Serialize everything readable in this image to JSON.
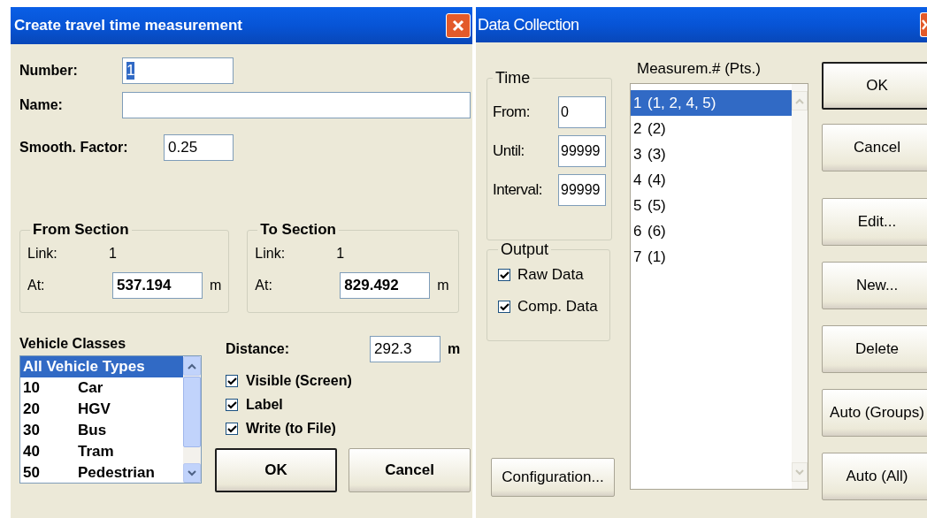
{
  "travel_time_dialog": {
    "title": "Create travel time measurement",
    "number": {
      "label": "Number:",
      "value": "1",
      "value_selected": true
    },
    "name": {
      "label": "Name:"
    },
    "smooth_factor": {
      "label": "Smooth. Factor:",
      "value": "0.25"
    },
    "sections": [
      {
        "title": "From Section",
        "link_label": "Link:",
        "link_value": "1",
        "at_label": "At:",
        "at_value": "537.194",
        "unit": "m"
      },
      {
        "title": "To Section",
        "link_label": "Link:",
        "link_value": "1",
        "at_label": "At:",
        "at_value": "829.492",
        "unit": "m"
      }
    ],
    "vehicle_classes": {
      "label": "Vehicle Classes",
      "items": [
        {
          "code": "All Vehicle Types",
          "selected": true
        },
        {
          "code": "10",
          "name": "Car",
          "selected": false
        },
        {
          "code": "20",
          "name": "HGV",
          "selected": false
        },
        {
          "code": "30",
          "name": "Bus",
          "selected": false
        },
        {
          "code": "40",
          "name": "Tram",
          "selected": false
        },
        {
          "code": "50",
          "name": "Pedestrian",
          "selected": false
        }
      ]
    },
    "distance": {
      "label": "Distance:",
      "value": "292.3",
      "unit": "m"
    },
    "options": [
      {
        "label": "Visible (Screen)",
        "checked": true
      },
      {
        "label": "Label",
        "checked": true
      },
      {
        "label": "Write (to File)",
        "checked": true
      }
    ],
    "buttons": [
      {
        "label": "OK",
        "default": true
      },
      {
        "label": "Cancel",
        "default": false
      }
    ]
  },
  "data_collection_dialog": {
    "title": "Data Collection",
    "time": {
      "title": "Time",
      "fields": [
        {
          "label": "From:",
          "value": "0"
        },
        {
          "label": "Until:",
          "value": "99999"
        },
        {
          "label": "Interval:",
          "value": "99999"
        }
      ]
    },
    "output": {
      "title": "Output",
      "options": [
        {
          "label": "Raw Data",
          "checked": true
        },
        {
          "label": "Comp. Data",
          "checked": true
        }
      ]
    },
    "configuration_button": "Configuration...",
    "measurements": {
      "label": "Measurem.# (Pts.)",
      "items": [
        {
          "number": "1",
          "points": "(1, 2, 4, 5)",
          "selected": true
        },
        {
          "number": "2",
          "points": "(2)",
          "selected": false
        },
        {
          "number": "3",
          "points": "(3)",
          "selected": false
        },
        {
          "number": "4",
          "points": "(4)",
          "selected": false
        },
        {
          "number": "5",
          "points": "(5)",
          "selected": false
        },
        {
          "number": "6",
          "points": "(6)",
          "selected": false
        },
        {
          "number": "7",
          "points": "(1)",
          "selected": false
        }
      ]
    },
    "buttons": [
      {
        "label": "OK",
        "default": true
      },
      {
        "label": "Cancel",
        "default": false
      },
      {
        "label": "Edit...",
        "default": false
      },
      {
        "label": "New...",
        "default": false
      },
      {
        "label": "Delete",
        "default": false
      },
      {
        "label": "Auto (Groups)",
        "default": false
      },
      {
        "label": "Auto (All)",
        "default": false
      }
    ]
  }
}
